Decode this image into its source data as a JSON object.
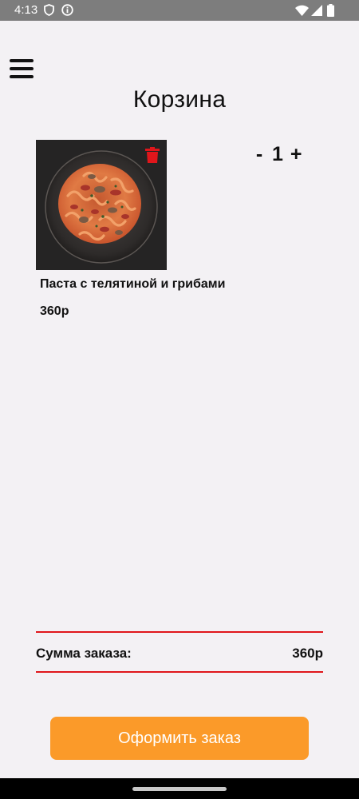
{
  "status_bar": {
    "time": "4:13",
    "icons": [
      "shield-icon",
      "info-icon",
      "wifi-icon",
      "signal-icon",
      "battery-icon"
    ],
    "background": "#7d7d7d"
  },
  "header": {
    "menu_icon": "hamburger-menu-icon",
    "title": "Корзина"
  },
  "cart": {
    "items": [
      {
        "name": "Паста с телятиной и грибами",
        "price": "360р",
        "image": "pasta-dish-image",
        "delete_icon": "trash-icon",
        "quantity": {
          "minus": "-",
          "value": "1",
          "plus": "+"
        }
      }
    ]
  },
  "summary": {
    "label": "Сумма заказа:",
    "value": "360р",
    "divider_color": "#e0161b"
  },
  "checkout": {
    "label": "Оформить заказ",
    "color": "#fb9a29"
  },
  "theme": {
    "background": "#f3f1f4",
    "accent_red": "#e0161b",
    "accent_orange": "#fb9a29"
  }
}
